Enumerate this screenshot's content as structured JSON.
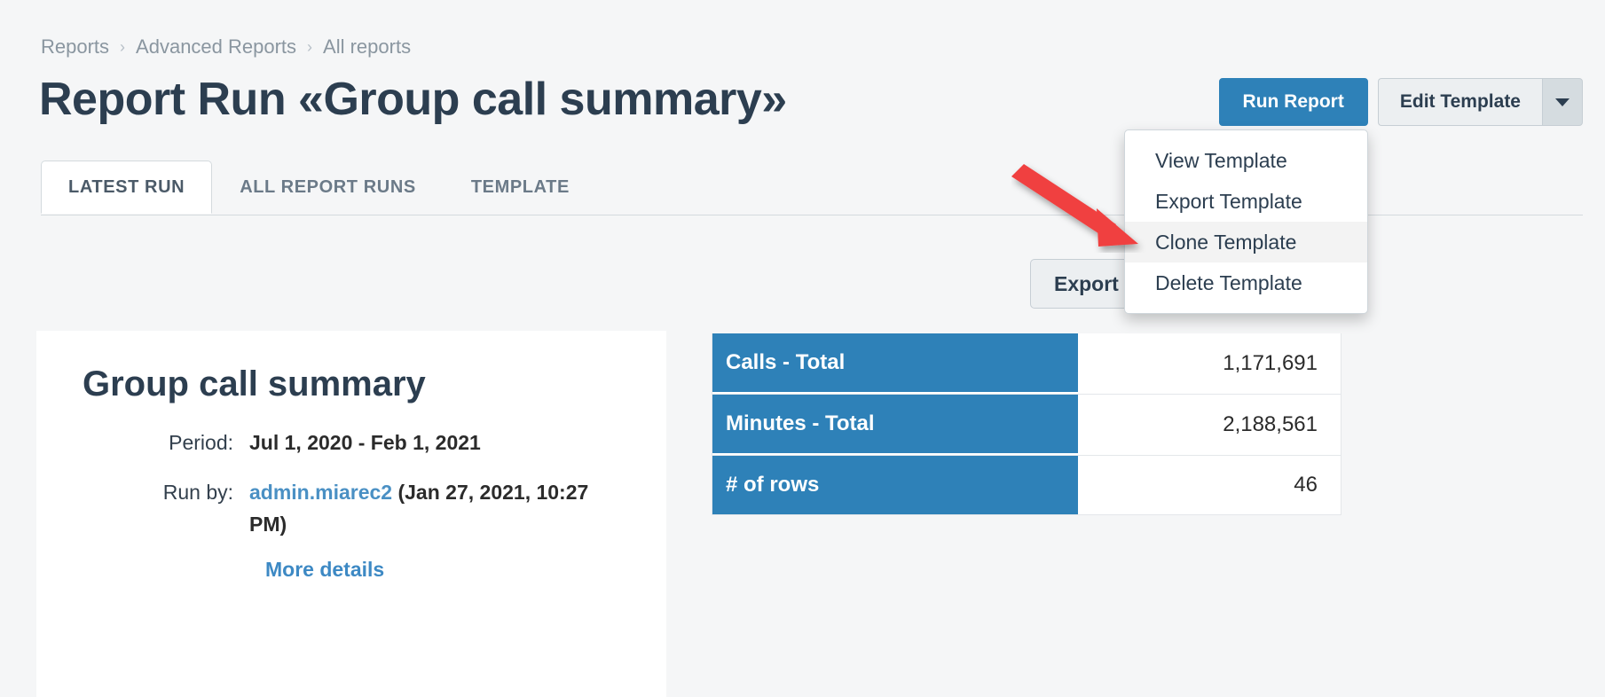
{
  "breadcrumb": {
    "items": [
      {
        "label": "Reports"
      },
      {
        "label": "Advanced Reports"
      },
      {
        "label": "All reports"
      }
    ],
    "separator": "›"
  },
  "header": {
    "title": "Report Run «Group call summary»",
    "run_report_label": "Run Report",
    "edit_template_label": "Edit Template",
    "caret_icon": "chevron-down-icon"
  },
  "dropdown": {
    "items": [
      {
        "label": "View Template",
        "active": false
      },
      {
        "label": "Export Template",
        "active": false
      },
      {
        "label": "Clone Template",
        "active": true
      },
      {
        "label": "Delete Template",
        "active": false
      }
    ]
  },
  "tabs": [
    {
      "label": "LATEST RUN",
      "active": true
    },
    {
      "label": "ALL REPORT RUNS",
      "active": false
    },
    {
      "label": "TEMPLATE",
      "active": false
    }
  ],
  "toolbar": {
    "export_label": "Export",
    "export_caret_icon": "caret-down-icon"
  },
  "summary": {
    "title": "Group call summary",
    "period_label": "Period:",
    "period_value": "Jul 1, 2020 - Feb 1, 2021",
    "run_by_label": "Run by:",
    "run_by_user": "admin.miarec2",
    "run_by_timestamp": "(Jan 27, 2021, 10:27 PM)",
    "more_details_label": "More details"
  },
  "stats": {
    "rows": [
      {
        "label": "Calls - Total",
        "value": "1,171,691"
      },
      {
        "label": "Minutes - Total",
        "value": "2,188,561"
      },
      {
        "label": "# of rows",
        "value": "46"
      }
    ]
  },
  "annotation": {
    "arrow_icon": "red-arrow-pointer",
    "color": "#f04040"
  },
  "colors": {
    "accent_blue": "#2e81b8",
    "link_blue": "#3d89c4",
    "page_background": "#f5f6f7",
    "card_background": "#ffffff",
    "muted_text": "#8a96a0",
    "heading_text": "#2c3e50"
  }
}
